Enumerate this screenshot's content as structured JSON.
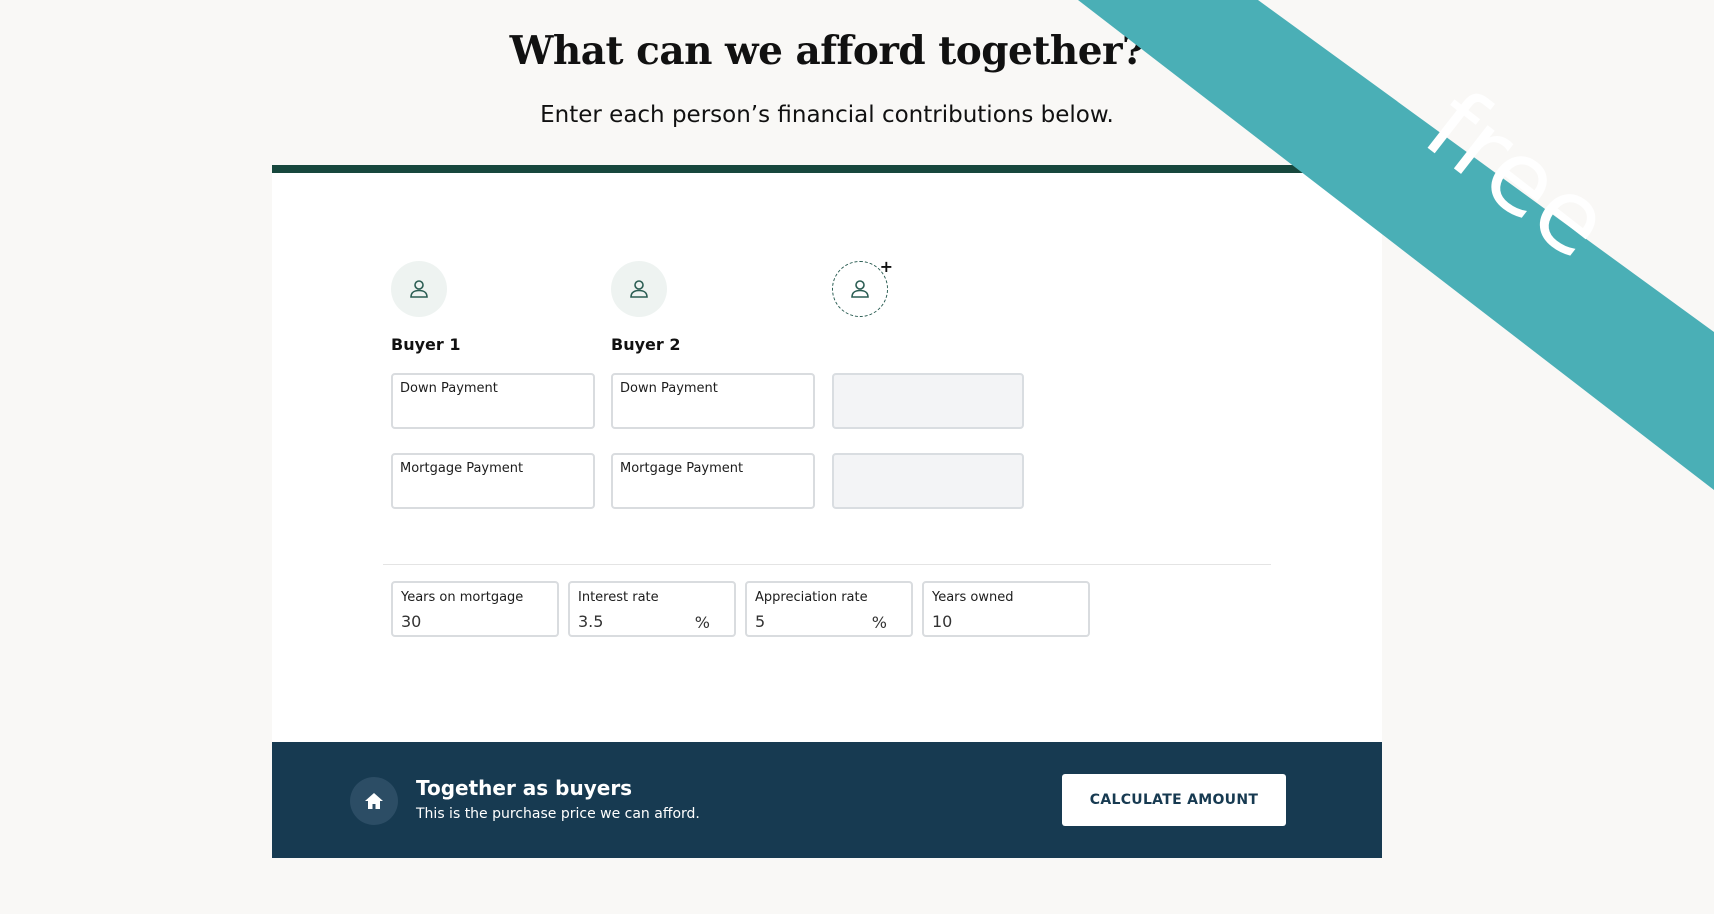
{
  "header": {
    "title": "What can we afford together?",
    "subtitle": "Enter each person’s financial contributions below."
  },
  "buyers": [
    {
      "name": "Buyer 1",
      "down_label": "Down Payment",
      "mortgage_label": "Mortgage Payment"
    },
    {
      "name": "Buyer 2",
      "down_label": "Down Payment",
      "mortgage_label": "Mortgage Payment"
    }
  ],
  "add_buyer": {
    "icon": "user-add-icon"
  },
  "params": {
    "years_on_mortgage": {
      "label": "Years on mortgage",
      "value": "30"
    },
    "interest_rate": {
      "label": "Interest rate",
      "value": "3.5",
      "unit": "%"
    },
    "appreciation_rate": {
      "label": "Appreciation rate",
      "value": "5",
      "unit": "%"
    },
    "years_owned": {
      "label": "Years owned",
      "value": "10"
    }
  },
  "footer": {
    "title": "Together as buyers",
    "subtitle": "This is the purchase price we can afford.",
    "button_label": "CALCULATE AMOUNT",
    "icon": "home-icon"
  },
  "ribbon": {
    "label": "free",
    "color": "#4aafb6"
  },
  "colors": {
    "accent_green": "#17473d",
    "footer_navy": "#173a51"
  }
}
